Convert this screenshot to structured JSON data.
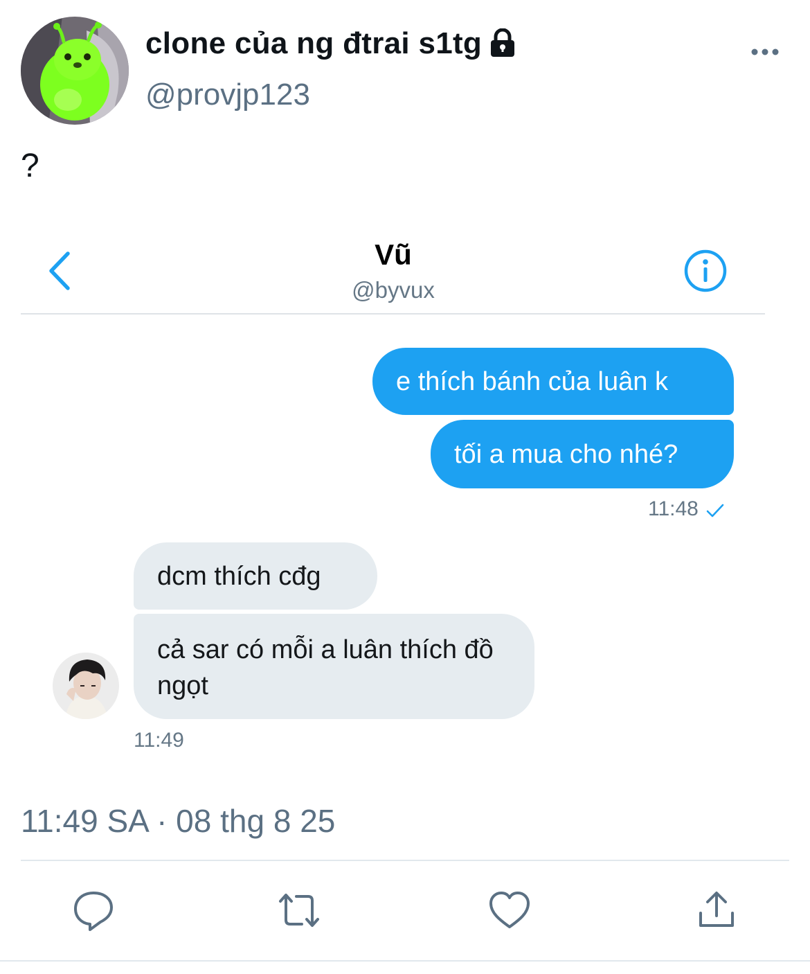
{
  "tweet": {
    "author_name": "clone của ng đtrai s1tg",
    "author_handle": "@provjp123",
    "text": "?",
    "timestamp": "11:49 SA · 08 thg 8 25"
  },
  "icons": {
    "lock": "lock-icon",
    "more": "more-horizontal-icon",
    "reply": "reply-icon",
    "retweet": "retweet-icon",
    "like": "heart-icon",
    "share": "share-icon"
  },
  "dm": {
    "contact_name": "Vũ",
    "contact_handle": "@byvux",
    "back_icon": "chevron-left-icon",
    "info_icon": "info-icon",
    "messages_sent": [
      "e thích bánh của luân k",
      "tối a mua cho nhé?"
    ],
    "sent_time": "11:48",
    "messages_received": [
      "dcm thích cđg",
      "cả sar có mỗi a luân thích đồ ngọt"
    ],
    "received_time": "11:49"
  },
  "colors": {
    "accent": "#1da1f2",
    "sent_bubble": "#1da1f2",
    "received_bubble": "#e6ecf0",
    "secondary_text": "#5b7083"
  }
}
